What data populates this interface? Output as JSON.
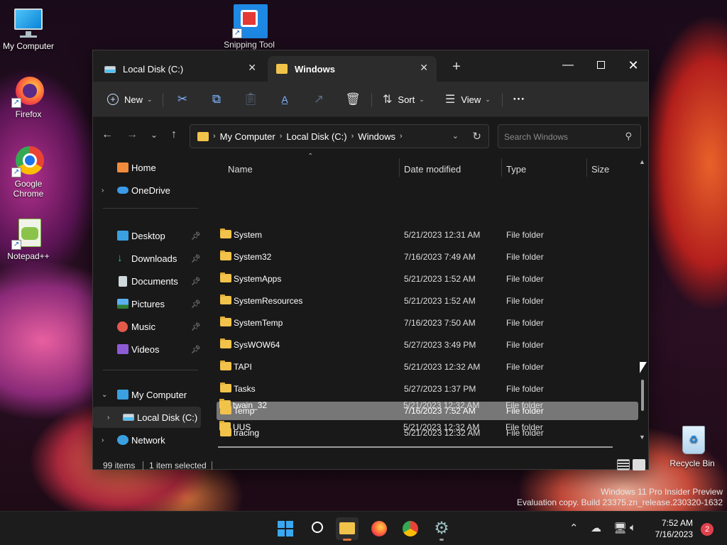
{
  "desktop": {
    "icons": [
      {
        "label": "My Computer"
      },
      {
        "label": "Firefox"
      },
      {
        "label": "Google Chrome"
      },
      {
        "label": "Notepad++"
      },
      {
        "label": "Snipping Tool"
      },
      {
        "label": "Recycle Bin"
      }
    ],
    "watermark": [
      "Windows 11 Pro Insider Preview",
      "Evaluation copy. Build 23375.zn_release.230320-1632"
    ]
  },
  "explorer": {
    "tabs": [
      {
        "label": "Local Disk (C:)"
      },
      {
        "label": "Windows"
      }
    ],
    "toolbar": {
      "new_label": "New",
      "sort_label": "Sort",
      "view_label": "View"
    },
    "address": {
      "crumbs": [
        "My Computer",
        "Local Disk (C:)",
        "Windows"
      ]
    },
    "search": {
      "placeholder": "Search Windows"
    },
    "nav": {
      "home": "Home",
      "onedrive": "OneDrive",
      "desktop": "Desktop",
      "downloads": "Downloads",
      "documents": "Documents",
      "pictures": "Pictures",
      "music": "Music",
      "videos": "Videos",
      "mycomputer": "My Computer",
      "localdisk": "Local Disk (C:)",
      "network": "Network"
    },
    "columns": {
      "name": "Name",
      "date": "Date modified",
      "type": "Type",
      "size": "Size"
    },
    "files": [
      {
        "name": "System",
        "date": "5/21/2023 12:31 AM",
        "type": "File folder"
      },
      {
        "name": "System32",
        "date": "7/16/2023 7:49 AM",
        "type": "File folder"
      },
      {
        "name": "SystemApps",
        "date": "5/21/2023 1:52 AM",
        "type": "File folder"
      },
      {
        "name": "SystemResources",
        "date": "5/21/2023 1:52 AM",
        "type": "File folder"
      },
      {
        "name": "SystemTemp",
        "date": "7/16/2023 7:50 AM",
        "type": "File folder"
      },
      {
        "name": "SysWOW64",
        "date": "5/27/2023 3:49 PM",
        "type": "File folder"
      },
      {
        "name": "TAPI",
        "date": "5/21/2023 12:32 AM",
        "type": "File folder"
      },
      {
        "name": "Tasks",
        "date": "5/27/2023 1:37 PM",
        "type": "File folder"
      },
      {
        "name": "Temp",
        "date": "7/16/2023 7:52 AM",
        "type": "File folder",
        "selected": true
      },
      {
        "name": "tracing",
        "date": "5/21/2023 12:32 AM",
        "type": "File folder"
      },
      {
        "name": "twain_32",
        "date": "5/21/2023 12:32 AM",
        "type": "File folder"
      },
      {
        "name": "UUS",
        "date": "5/21/2023 12:32 AM",
        "type": "File folder"
      }
    ],
    "status": {
      "items": "99 items",
      "selected": "1 item selected"
    }
  },
  "taskbar": {
    "time": "7:52 AM",
    "date": "7/16/2023",
    "notifications": "2"
  }
}
